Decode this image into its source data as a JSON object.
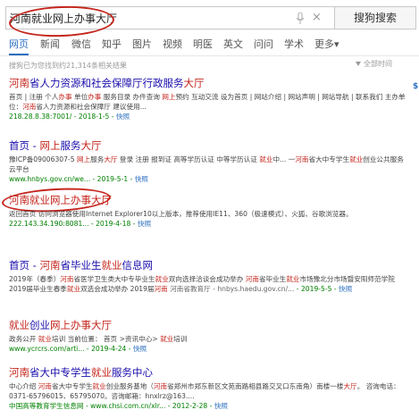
{
  "search": {
    "query": "河南就业网上办事大厅",
    "button_label": "搜狗搜索",
    "clear_glyph": "×"
  },
  "tabs": [
    "网页",
    "新闻",
    "微信",
    "知乎",
    "图片",
    "视频",
    "明医",
    "英文",
    "问问",
    "学术",
    "更多▾"
  ],
  "result_count": "搜狗已为您找到约21,314条相关结果",
  "time_filter": "全部时间",
  "right_mark": "$",
  "results": [
    {
      "title": "河南省人力资源和社会保障厅行政服务大厅",
      "snippet": "首页 | 注册 个人办事 单位办事 服务目录 办件查询 网上预约 互动交流 设为首页 | 网站介绍 | 网站声明 | 网站导航 | 联系我们 主办单位：河南省人力资源和社会保障厅 建议使用...",
      "url": "218.28.8.38:7001/ - 2018-1-5 - ",
      "snapshot": "快照"
    },
    {
      "title": "首页 - 网上服务大厅",
      "snippet": "豫ICP备09006307-5 网上服务大厅 登录 注册 报到证 高等学历认证 中等学历认证 就业中... 一河南省大中专学生就业创业公共服务云平台",
      "url": "www.hnbys.gov.cn/we... - 2019-5-1 - ",
      "snapshot": "快照"
    },
    {
      "title": "河南就业网上办事大厅",
      "snippet": "返回首页 访问浏览器使用Internet Explorer10以上版本，推荐使用IE11、360（极速模式）、火狐、谷歌浏览器。",
      "url": "222.143.34.190:8081... - 2019-4-18 - ",
      "snapshot": "快照"
    },
    {
      "title": "首页 - 河南省毕业生就业信息网",
      "snippet": "2019年（春季）河南省医学卫生类大中专毕业生就业双向选择洽谈会成功举办 河南省毕业生就业市场豫北分市场暨安阳师范学院2019届毕业生春季就业双选会成功举办 2019届河南 河南省教育厅 - hnbys.haedu.gov.cn/...",
      "url": " - 2019-5-5 - ",
      "snapshot": "快照"
    },
    {
      "title": "就业创业网上办事大厅",
      "snippet": "政务公开 就业培训 当前位置： 首页 >资讯中心> 就业培训",
      "url": "www.ycrcrs.com/arti... - 2019-4-24 - ",
      "snapshot": "快照"
    },
    {
      "title": "河南省大中专学生就业服务中心",
      "snippet": "中心介绍 河南省大中专学生就业创业服务基地（河南省郑州市郑东新区文苑南路相县路交叉口东南角）南楼一楼大厅。 咨询电话：0371-65796015、65795070。咨询邮箱：hnxlrz@163....",
      "url": "中国高等教育学生信息网 - www.chsi.com.cn/xlr... - 2012-2-28 - ",
      "snapshot": "快照"
    }
  ],
  "colors": {
    "highlight": "#c4261d",
    "link": "#1a0dab",
    "url": "#008000",
    "accent": "#2c6fbf"
  }
}
